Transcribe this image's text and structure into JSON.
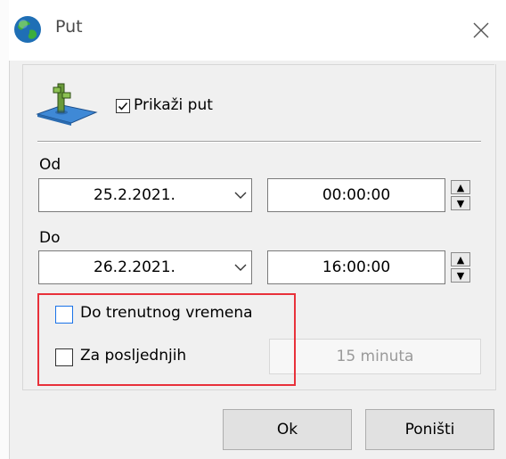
{
  "window": {
    "title": "Put",
    "close_glyph": "✕"
  },
  "show_route": {
    "label": "Prikaži put",
    "checked": true
  },
  "from": {
    "label": "Od",
    "date": "25.2.2021.",
    "time": "00:00:00"
  },
  "to": {
    "label": "Do",
    "date": "26.2.2021.",
    "time": "16:00:00"
  },
  "options": {
    "until_now_label": "Do trenutnog vremena",
    "until_now_checked": false,
    "last_label": "Za posljednjih",
    "last_checked": false,
    "last_value": "15 minuta"
  },
  "buttons": {
    "ok": "Ok",
    "cancel": "Poništi"
  },
  "colors": {
    "highlight": "#e8313a",
    "focus_blue": "#1a73e8"
  },
  "icons": {
    "app": "globe-icon",
    "route": "route-map-pin-icon"
  }
}
